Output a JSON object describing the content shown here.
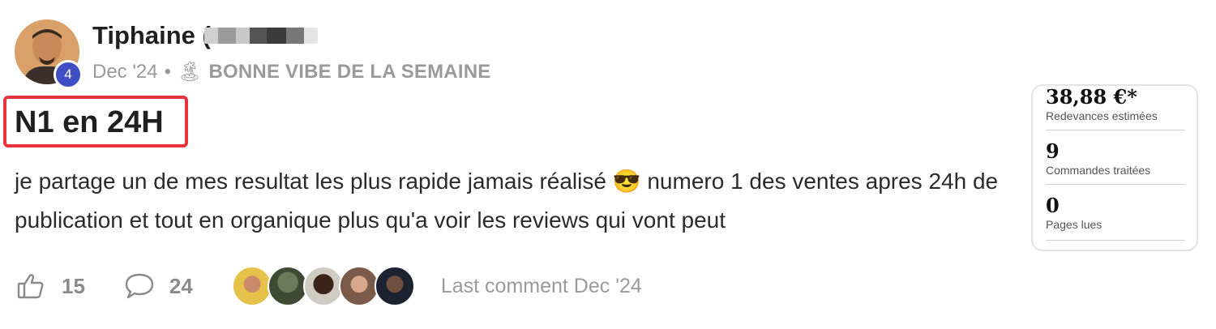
{
  "author": {
    "name": "Tiphaine (",
    "level": "4"
  },
  "meta": {
    "date": "Dec '24",
    "separator": "•",
    "category_icon": "🏝",
    "category": "BONNE VIBE DE LA SEMAINE"
  },
  "post": {
    "title": "N1 en 24H",
    "body": "je partage un de mes resultat les plus rapide jamais réalisé 😎 numero 1 des ventes apres 24h de publication et tout en organique plus qu'a voir les reviews qui vont peut"
  },
  "stats_card": {
    "items": [
      {
        "value": "38,88 €*",
        "label": "Redevances estimées"
      },
      {
        "value": "9",
        "label": "Commandes traitées"
      },
      {
        "value": "0",
        "label": "Pages lues"
      }
    ]
  },
  "footer": {
    "likes": "15",
    "comments": "24",
    "last_comment": "Last comment Dec '24"
  },
  "colors": {
    "highlight_border": "#e8333f",
    "level_badge": "#3f4fc3",
    "muted_text": "#9a9a9a"
  }
}
